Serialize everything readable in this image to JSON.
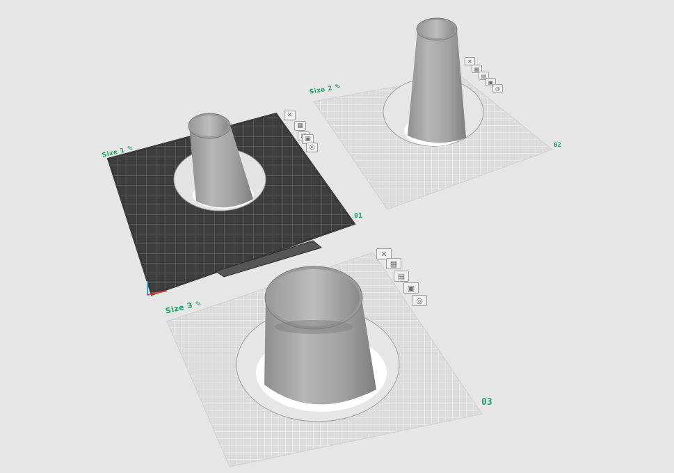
{
  "plates": [
    {
      "name_label": "Size 1",
      "number": "01",
      "icons": [
        "close-icon",
        "auto-arrange-icon",
        "orient-icon",
        "lock-icon",
        "settings-icon"
      ]
    },
    {
      "name_label": "Size 2",
      "number": "02",
      "icons": [
        "close-icon",
        "auto-arrange-icon",
        "orient-icon",
        "lock-icon",
        "settings-icon"
      ]
    },
    {
      "name_label": "Size 3",
      "number": "03",
      "icons": [
        "close-icon",
        "auto-arrange-icon",
        "orient-icon",
        "lock-icon",
        "settings-icon"
      ]
    }
  ],
  "colors": {
    "accent": "#1fa463",
    "background": "#e6e6e6",
    "plate_dark": "#3f3f3f",
    "plate_light": "#dedede",
    "model": "#a8a8a8"
  },
  "icon_glyphs": {
    "close-icon": "✕",
    "auto-arrange-icon": "▦",
    "orient-icon": "▤",
    "lock-icon": "▣",
    "settings-icon": "◎"
  }
}
